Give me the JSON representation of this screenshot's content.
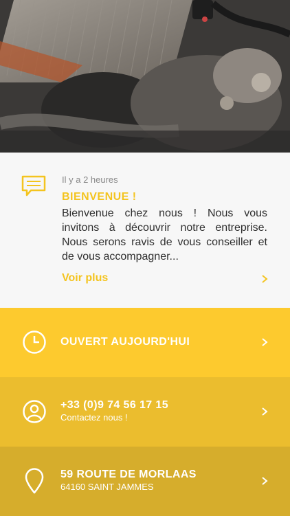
{
  "news": {
    "time": "Il y a 2 heures",
    "title": "BIENVENUE !",
    "body": "Bienvenue chez nous ! Nous vous invitons à découvrir notre entreprise. Nous serons ravis de vous conseiller et de vous accompagner...",
    "more_label": "Voir plus",
    "icon": "message-icon"
  },
  "rows": [
    {
      "title": "OUVERT AUJOURD'HUI",
      "subtitle": "",
      "icon": "clock-icon"
    },
    {
      "title": "+33 (0)9 74 56 17 15",
      "subtitle": "Contactez nous !",
      "icon": "contact-icon"
    },
    {
      "title": "59 ROUTE DE MORLAAS",
      "subtitle": "64160 SAINT JAMMES",
      "icon": "location-pin-icon"
    }
  ],
  "colors": {
    "accent": "#f4c41f",
    "row1": "#fdca2e",
    "row2": "#ebbd2e",
    "row3": "#d6ad2c"
  }
}
